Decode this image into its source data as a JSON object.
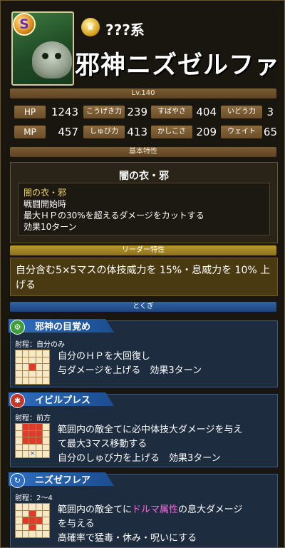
{
  "header": {
    "rank": "S",
    "type_label": "???系",
    "monster_name": "邪神ニズゼルファ",
    "level": "Lv.140"
  },
  "stats": [
    [
      {
        "label": "HP",
        "value": "1243"
      },
      {
        "label": "こうげき力",
        "value": "239"
      },
      {
        "label": "すばやさ",
        "value": "404"
      },
      {
        "label": "いどう力",
        "value": "3"
      }
    ],
    [
      {
        "label": "MP",
        "value": "457"
      },
      {
        "label": "しゅび力",
        "value": "413"
      },
      {
        "label": "かしこさ",
        "value": "209"
      },
      {
        "label": "ウェイト",
        "value": "65"
      }
    ]
  ],
  "passive": {
    "section_label": "基本特性",
    "title": "闇の衣・邪",
    "name": "闇の衣・邪",
    "lines": [
      "戦闘開始時",
      "最大ＨＰの30%を超えるダメージをカットする",
      "効果10ターン"
    ]
  },
  "leader": {
    "section_label": "リーダー特性",
    "text": "自分含む5×5マスの体技威力を 15%・息威力を 10% 上げる"
  },
  "skills_section_label": "とくぎ",
  "skills": [
    {
      "name": "邪神の目覚め",
      "icon": "gear-icon",
      "icon_color": "#3f9d3a",
      "range": "射程：自分のみ",
      "desc_lines": [
        "自分のＨＰを大回復し",
        "与ダメージを上げる　効果3ターン"
      ]
    },
    {
      "name": "イビルプレス",
      "icon": "sparkle-icon",
      "icon_color": "#c0392b",
      "range": "射程：前方",
      "desc_lines": [
        "範囲内の敵全てに必中体技大ダメージを与え",
        "て最大3マス移動する",
        "自分のしゅび力を上げる　効果3ターン"
      ]
    },
    {
      "name": "ニズゼフレア",
      "icon": "refresh-icon",
      "icon_color": "#2e6ec0",
      "range": "射程：2〜4",
      "desc_prefix": "範囲内の敵全てに",
      "desc_highlight": "ドルマ属性",
      "desc_suffix": "の息大ダメージ",
      "desc_lines": [
        "を与える",
        "高確率で猛毒・休み・呪いにする"
      ]
    }
  ]
}
